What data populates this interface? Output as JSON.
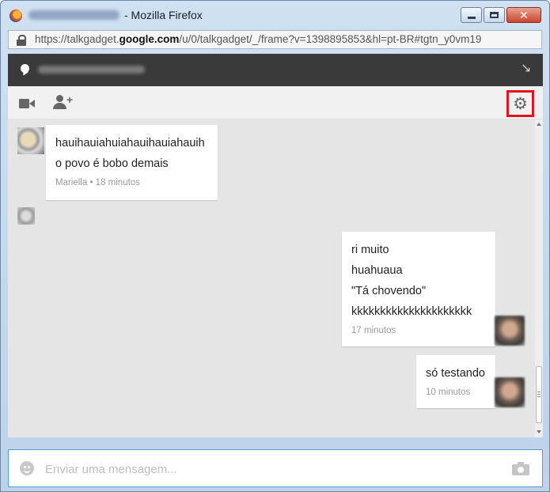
{
  "window": {
    "title": "- Mozilla Firefox",
    "url_prefix": "https://talkgadget.",
    "url_domain": "google.com",
    "url_suffix": "/u/0/talkgadget/_/frame?v=1398895853&hl=pt-BR#tgtn_y0vm19"
  },
  "messages": [
    {
      "lines": [
        "hauihauiahuiahauihauiahauih",
        "o povo é bobo demais"
      ],
      "meta": "Mariella • 18 minutos"
    },
    {
      "lines": [
        "ri muito",
        "huahuaua",
        "\"Tá chovendo\"",
        "kkkkkkkkkkkkkkkkkkkkk"
      ],
      "meta": "17 minutos"
    },
    {
      "lines": [
        "só testando"
      ],
      "meta": "10 minutos"
    }
  ],
  "composer": {
    "placeholder": "Enviar uma mensagem..."
  },
  "colors": {
    "header_dark": "#3a3a3a",
    "highlight_red": "#e0141b",
    "chat_bg": "#e5e5e5"
  }
}
